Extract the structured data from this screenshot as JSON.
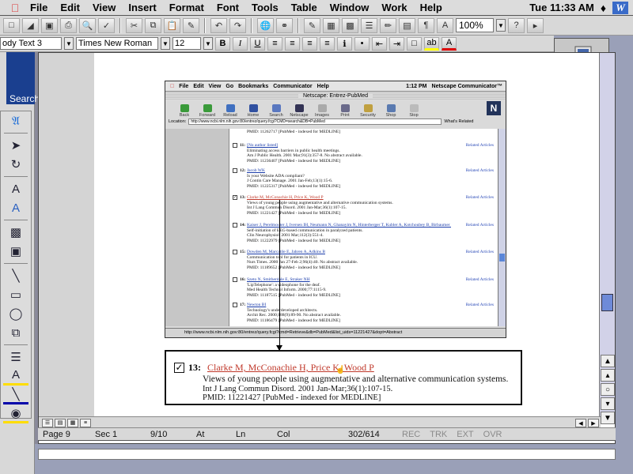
{
  "menubar": {
    "items": [
      "File",
      "Edit",
      "View",
      "Insert",
      "Format",
      "Font",
      "Tools",
      "Table",
      "Window",
      "Work",
      "Help"
    ],
    "clock": "Tue 11:33 AM",
    "app_icon_letter": "W"
  },
  "toolbar": {
    "zoom": "100%",
    "style": "ody Text 3",
    "font": "Times New Roman",
    "size": "12"
  },
  "left_stub": {
    "label": "Search"
  },
  "embedded_browser": {
    "menus": [
      "File",
      "Edit",
      "View",
      "Go",
      "Bookmarks",
      "Communicator",
      "Help"
    ],
    "clock": "1:12 PM",
    "app_name": "Netscape Communicator™",
    "title": "Netscape: Entrez-PubMed",
    "tools": [
      "Back",
      "Forward",
      "Reload",
      "Home",
      "Search",
      "Netscape",
      "Images",
      "Print",
      "Security",
      "Shop",
      "Stop"
    ],
    "location_label": "Location:",
    "url": "http://www.ncbi.nlm.nih.gov:80/entrez/query.fcgi?CMD=search&DB=PubMed",
    "whats_related": "What's Related",
    "status_url": "http://www.ncbi.nlm.nih.gov:80/entrez/query.fcgi?cmd=Retrieve&db=PubMed&list_uids=11221427&dopt=Abstract",
    "rows": [
      {
        "num": "",
        "auth": "",
        "title": "",
        "journal": "",
        "pmid": "PMID: 11262717 [PubMed - indexed for MEDLINE]",
        "related": ""
      },
      {
        "num": "11:",
        "auth": "[No author listed]",
        "title": "Eliminating access barriers in public health meetings.",
        "journal": "Am J Public Health. 2001 Mar;91(3):357-8. No abstract available.",
        "pmid": "PMID: 11236407 [PubMed - indexed for MEDLINE]",
        "related": "Related Articles"
      },
      {
        "num": "12:",
        "auth": "Jacob WK",
        "title": "Is your Website ADA compliant?",
        "journal": "J Contin Care Manage. 2001 Jan-Feb;13(1):15-6.",
        "pmid": "PMID: 11225317 [PubMed - indexed for MEDLINE]",
        "related": "Related Articles"
      },
      {
        "num": "13:",
        "auth": "Clarke M, McConachie H, Price K, Wood P",
        "title": "Views of young people using augmentative and alternative communication systems.",
        "journal": "Int J Lang Commun Disord. 2001 Jan-Mar;36(1):107-15.",
        "pmid": "PMID: 11221427 [PubMed - indexed for MEDLINE]",
        "related": "Related Articles"
      },
      {
        "num": "14:",
        "auth": "Kaiser J, Perelmouter J, Iversen IH, Neumann N, Ghanayim N, Hinterberger T, Kubler A, Kotchoubey B, Birbaumer N",
        "title": "Self-initiation of EEG-based communication in paralyzed patients.",
        "journal": "Clin Neurophysiol. 2001 Mar;112(3):551-4.",
        "pmid": "PMID: 11222979 [PubMed - indexed for MEDLINE]",
        "related": "Related Articles"
      },
      {
        "num": "15:",
        "auth": "Dowden M, Marcatile E, Jahren A, Adkins B",
        "title": "Communication tool for patients in ICU.",
        "journal": "Nurs Times. 2000 Jan 27-Feb 2;96(4):40. No abstract available.",
        "pmid": "PMID: 11189652 [PubMed - indexed for MEDLINE]",
        "related": "Related Articles"
      },
      {
        "num": "16:",
        "auth": "Szeto N, Smitherdale E, Straker NH",
        "title": "'LipTelephone': a videophone for the deaf.",
        "journal": "Med Health Technol Inform. 2000;77:1115-9.",
        "pmid": "PMID: 11187515 [PubMed - indexed for MEDLINE]",
        "related": "Related Articles"
      },
      {
        "num": "17:",
        "auth": "Newton BI",
        "title": "Technology's underdeveloped architects.",
        "journal": "Archit Rec. 2000;188(9):89-90. No abstract available.",
        "pmid": "PMID: 11186479 [PubMed - indexed for MEDLINE]",
        "related": "Related Articles"
      }
    ]
  },
  "callout": {
    "num": "13:",
    "authors": "Clarke M, McConachie H, Price K, Wood P",
    "title": "Views of young people using augmentative and alternative communication systems.",
    "journal": "Int J Lang Commun Disord. 2001 Jan-Mar;36(1):107-15.",
    "pmid": "PMID: 11221427 [PubMed - indexed for MEDLINE]"
  },
  "status": {
    "page": "Page 9",
    "sec": "Sec 1",
    "pages": "9/10",
    "at": "At",
    "ln": "Ln",
    "col": "Col",
    "words": "302/614",
    "rec": "REC",
    "trk": "TRK",
    "ext": "EXT",
    "ovr": "OVR"
  }
}
